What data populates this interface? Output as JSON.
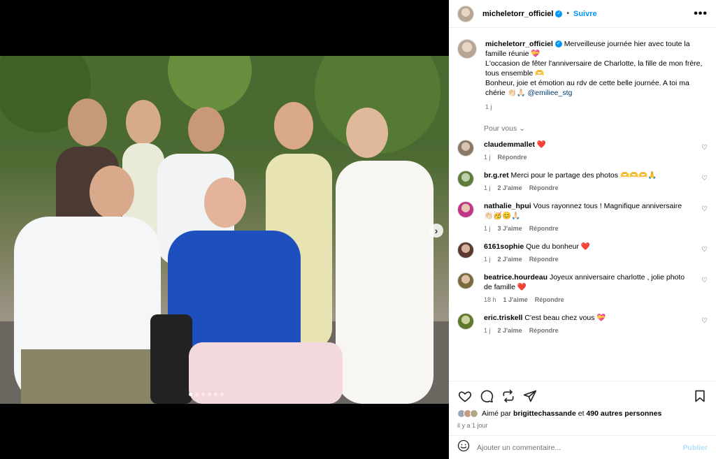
{
  "post": {
    "author": "micheletorr_officiel",
    "follow_label": "Suivre",
    "separator": "•",
    "more_label": "•••"
  },
  "caption": {
    "author": "micheletorr_officiel",
    "line1": "Merveilleuse journée hier avec toute la famille réunie 💝",
    "line2": "L'occasion de fêter l'anniversaire de Charlotte, la fille de mon frère, tous ensemble 🫶",
    "line3": "Bonheur, joie et émotion au rdv de cette belle journée. A toi ma chérie 👏🏻🙏🏻",
    "mention": "@emiliee_stg",
    "time": "1 j"
  },
  "section_label": "Pour vous ⌄",
  "comments": [
    {
      "user": "claudemmallet",
      "text": "❤️",
      "time": "1 j",
      "likes": "",
      "reply": "Répondre"
    },
    {
      "user": "br.g.ret",
      "text": "Merci pour le partage des photos 🫶🫶🫶🙏",
      "time": "1 j",
      "likes": "2 J'aime",
      "reply": "Répondre"
    },
    {
      "user": "nathalie_hpui",
      "text": "Vous rayonnez tous ! Magnifique anniversaire 👏🏻🥳😊🙏🏻",
      "time": "1 j",
      "likes": "3 J'aime",
      "reply": "Répondre"
    },
    {
      "user": "6161sophie",
      "text": "Que du bonheur ❤️",
      "time": "1 j",
      "likes": "2 J'aime",
      "reply": "Répondre"
    },
    {
      "user": "beatrice.hourdeau",
      "text": "Joyeux anniversaire charlotte , jolie photo de famille ❤️",
      "time": "18 h",
      "likes": "1 J'aime",
      "reply": "Répondre"
    },
    {
      "user": "eric.triskell",
      "text": "C'est beau chez vous 💝",
      "time": "1 j",
      "likes": "2 J'aime",
      "reply": "Répondre"
    }
  ],
  "likes": {
    "prefix": "Aimé par",
    "user": "brigittechassande",
    "suffix": "et",
    "others": "490 autres personnes"
  },
  "time_ago": "il y a 1 jour",
  "add_comment": {
    "placeholder": "Ajouter un commentaire...",
    "publish_label": "Publier"
  },
  "carousel": {
    "next_label": "›",
    "total": 6,
    "active": 1
  }
}
